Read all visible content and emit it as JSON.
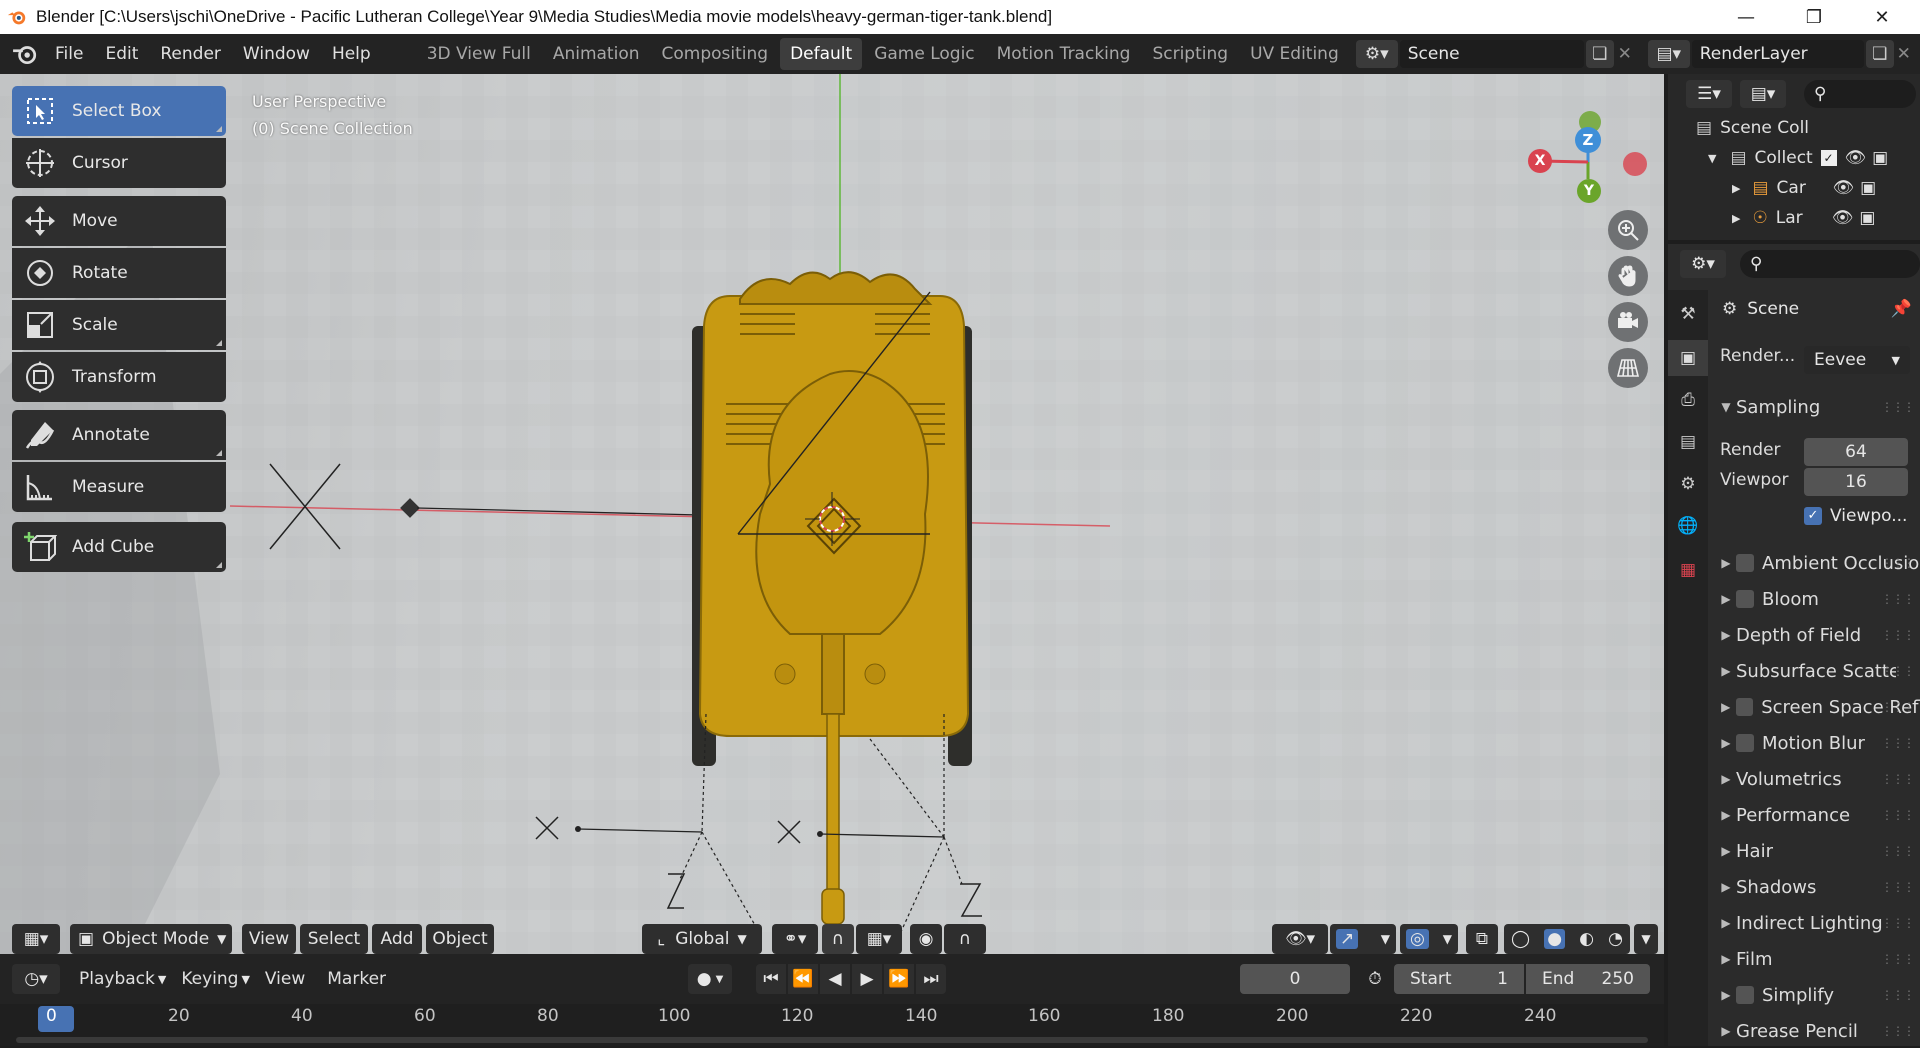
{
  "window": {
    "title": "Blender [C:\\Users\\jschi\\OneDrive - Pacific Lutheran College\\Year 9\\Media Studies\\Media movie models\\heavy-german-tiger-tank.blend]",
    "controls": [
      "minimize-icon",
      "restore-icon",
      "close-icon"
    ]
  },
  "menubar": {
    "menus": [
      "File",
      "Edit",
      "Render",
      "Window",
      "Help"
    ],
    "workspaces": [
      "3D View Full",
      "Animation",
      "Compositing",
      "Default",
      "Game Logic",
      "Motion Tracking",
      "Scripting",
      "UV Editing"
    ],
    "active_workspace": "Default",
    "scene": "Scene",
    "view_layer": "RenderLayer"
  },
  "viewport": {
    "perspective": "User Perspective",
    "collection": "(0) Scene Collection",
    "tools": [
      {
        "label": "Select Box",
        "icon": "select-box-icon",
        "active": true
      },
      {
        "label": "Cursor",
        "icon": "cursor-icon"
      },
      {
        "label": "Move",
        "icon": "move-icon"
      },
      {
        "label": "Rotate",
        "icon": "rotate-icon"
      },
      {
        "label": "Scale",
        "icon": "scale-icon"
      },
      {
        "label": "Transform",
        "icon": "transform-icon"
      },
      {
        "label": "Annotate",
        "icon": "annotate-icon"
      },
      {
        "label": "Measure",
        "icon": "measure-icon"
      },
      {
        "label": "Add Cube",
        "icon": "add-cube-icon"
      }
    ],
    "gizmo_axes": [
      "X",
      "Y",
      "Z"
    ],
    "header": {
      "mode": "Object Mode",
      "menus": [
        "View",
        "Select",
        "Add",
        "Object"
      ],
      "orientation": "Global"
    },
    "colors": {
      "object": "#c89a12",
      "axis_x": "#d9434f",
      "axis_y": "#6aa52a",
      "axis_z": "#3f8fd8"
    }
  },
  "timeline": {
    "menus": [
      "Playback",
      "Keying",
      "View",
      "Marker"
    ],
    "current_frame": "0",
    "start_label": "Start",
    "start": "1",
    "end_label": "End",
    "end": "250",
    "ticks": [
      "0",
      "20",
      "40",
      "60",
      "80",
      "100",
      "120",
      "140",
      "160",
      "180",
      "200",
      "220",
      "240"
    ]
  },
  "outliner": {
    "root": "Scene Coll",
    "items": [
      {
        "label": "Collect",
        "icon": "collection-icon"
      },
      {
        "label": "Car",
        "icon": "camera-icon"
      },
      {
        "label": "Lar",
        "icon": "light-icon"
      }
    ]
  },
  "properties": {
    "context": "Scene",
    "render_engine_label": "Render...",
    "render_engine": "Eevee",
    "sampling": {
      "label": "Sampling",
      "render_label": "Render",
      "render": "64",
      "viewport_label": "Viewpor",
      "viewport": "16",
      "denoise_label": "Viewpo..."
    },
    "sections": [
      {
        "label": "Ambient Occlusio",
        "checkbox": true
      },
      {
        "label": "Bloom",
        "checkbox": true
      },
      {
        "label": "Depth of Field",
        "checkbox": false
      },
      {
        "label": "Subsurface Scatterir",
        "checkbox": false
      },
      {
        "label": "Screen Space Refl",
        "checkbox": true
      },
      {
        "label": "Motion Blur",
        "checkbox": true
      },
      {
        "label": "Volumetrics",
        "checkbox": false
      },
      {
        "label": "Performance",
        "checkbox": false
      },
      {
        "label": "Hair",
        "checkbox": false
      },
      {
        "label": "Shadows",
        "checkbox": false
      },
      {
        "label": "Indirect Lighting",
        "checkbox": false
      },
      {
        "label": "Film",
        "checkbox": false
      },
      {
        "label": "Simplify",
        "checkbox": true
      },
      {
        "label": "Grease Pencil",
        "checkbox": false
      }
    ]
  }
}
